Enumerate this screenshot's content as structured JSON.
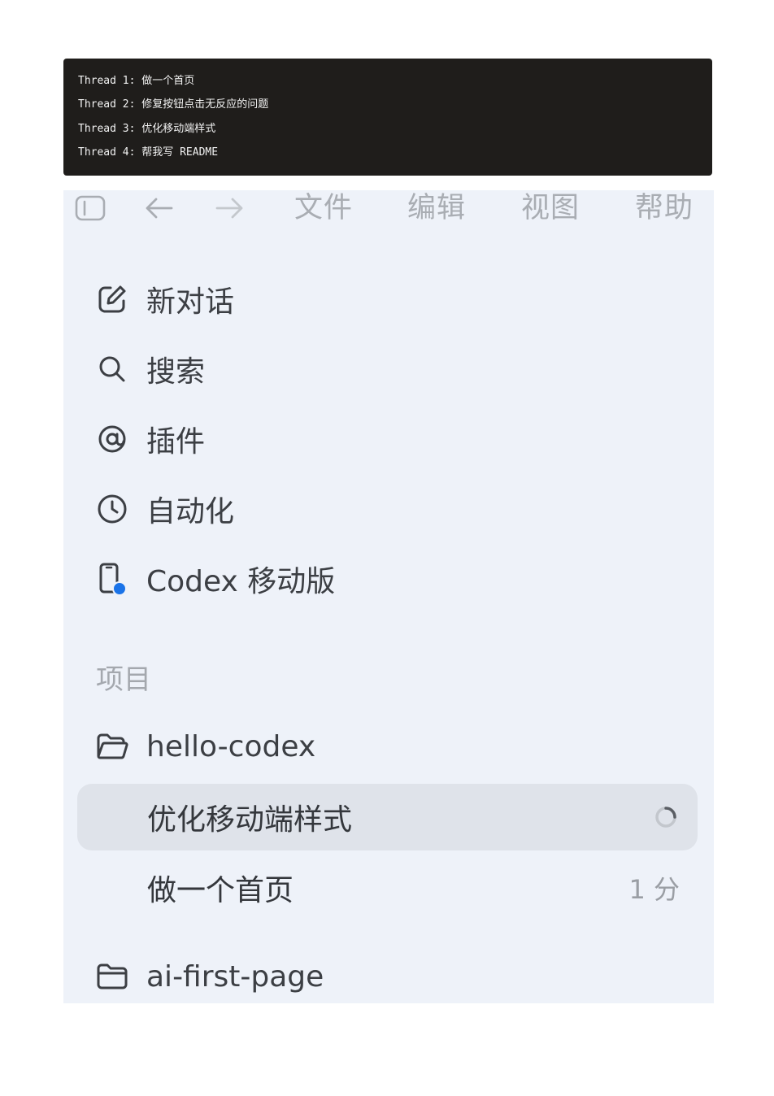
{
  "code_block": {
    "lines": [
      "Thread 1: 做一个首页",
      "Thread 2: 修复按钮点击无反应的问题",
      "Thread 3: 优化移动端样式",
      "Thread 4: 帮我写 README"
    ]
  },
  "toolbar": {
    "sidebar_toggle_icon": "sidebar-icon",
    "back_icon": "arrow-left-icon",
    "forward_icon": "arrow-right-icon",
    "menus": [
      "文件",
      "编辑",
      "视图",
      "帮助"
    ]
  },
  "nav": {
    "items": [
      {
        "label": "新对话",
        "icon": "edit-icon"
      },
      {
        "label": "搜索",
        "icon": "search-icon"
      },
      {
        "label": "插件",
        "icon": "at-icon"
      },
      {
        "label": "自动化",
        "icon": "clock-icon"
      },
      {
        "label": "Codex 移动版",
        "icon": "mobile-icon"
      }
    ]
  },
  "projects": {
    "section_label": "项目",
    "items": [
      {
        "name": "hello-codex",
        "icon": "folder-open-icon",
        "threads": [
          {
            "title": "优化移动端样式",
            "status": "loading-spinner-icon",
            "active": true
          },
          {
            "title": "做一个首页",
            "time": "1 分",
            "active": false
          }
        ]
      },
      {
        "name": "ai-first-page",
        "icon": "folder-icon"
      }
    ]
  },
  "colors": {
    "code_bg": "#1f1d1b",
    "sidebar_bg": "#eef2f9",
    "active_row_bg": "#dfe3ea",
    "badge_blue": "#1a73e8"
  }
}
